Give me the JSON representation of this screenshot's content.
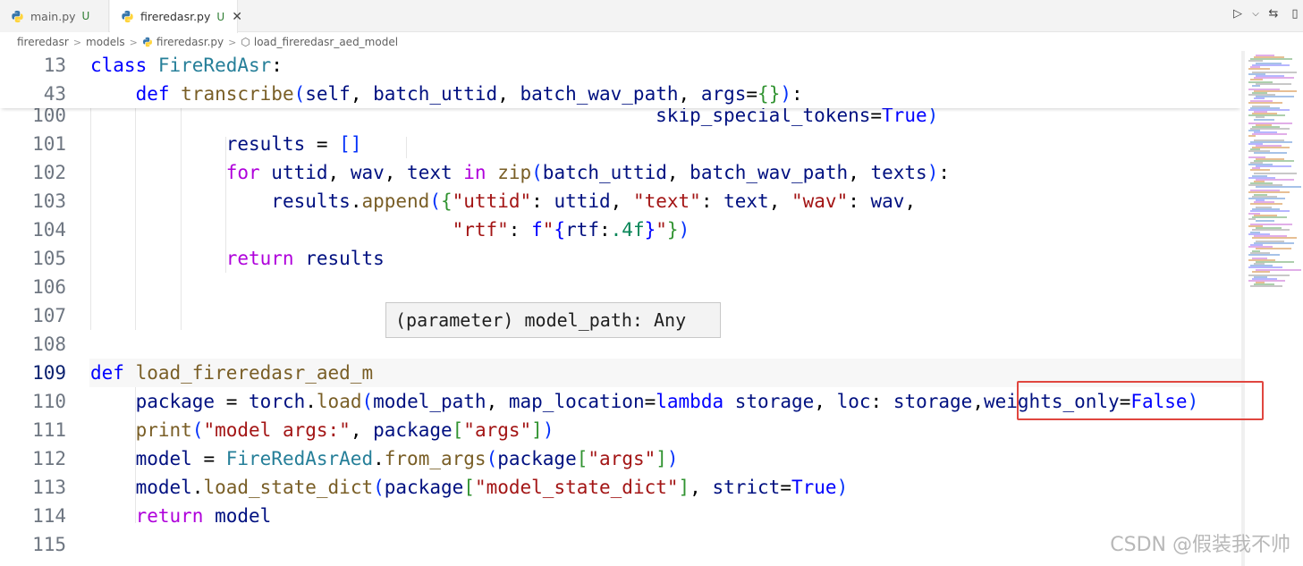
{
  "tabs": [
    {
      "label": "main.py",
      "status": "U",
      "active": false
    },
    {
      "label": "fireredasr.py",
      "status": "U",
      "active": true,
      "close": "✕"
    }
  ],
  "toolbar": {
    "run": "▷",
    "run_menu": "⌵",
    "compare": "⇆",
    "split": "▯"
  },
  "breadcrumb": [
    "fireredasr",
    "models",
    "fireredasr.py",
    "load_fireredasr_aed_model"
  ],
  "editor": {
    "sticky_lines": [
      {
        "no": "13",
        "tokens": [
          [
            "kw2",
            "class "
          ],
          [
            "cls",
            "FireRedAsr"
          ],
          [
            "plain",
            ":"
          ]
        ]
      },
      {
        "no": "43",
        "tokens": [
          [
            "plain",
            "    "
          ],
          [
            "kw2",
            "def "
          ],
          [
            "fn",
            "transcribe"
          ],
          [
            "br1",
            "("
          ],
          [
            "var",
            "self"
          ],
          [
            "plain",
            ", "
          ],
          [
            "var",
            "batch_uttid"
          ],
          [
            "plain",
            ", "
          ],
          [
            "var",
            "batch_wav_path"
          ],
          [
            "plain",
            ", "
          ],
          [
            "var",
            "args"
          ],
          [
            "plain",
            "="
          ],
          [
            "br2",
            "{}"
          ],
          [
            "br1",
            ")"
          ],
          [
            "plain",
            ":"
          ]
        ]
      }
    ],
    "lines": [
      {
        "no": "100",
        "tokens": [
          [
            "plain",
            "                                                  "
          ],
          [
            "var",
            "skip_special_tokens"
          ],
          [
            "plain",
            "="
          ],
          [
            "kw2",
            "True"
          ],
          [
            "br1",
            ")"
          ]
        ]
      },
      {
        "no": "101",
        "tokens": [
          [
            "plain",
            "            "
          ],
          [
            "var",
            "results"
          ],
          [
            "plain",
            " = "
          ],
          [
            "br1",
            "[]"
          ]
        ]
      },
      {
        "no": "102",
        "tokens": [
          [
            "plain",
            "            "
          ],
          [
            "kw",
            "for "
          ],
          [
            "var",
            "uttid"
          ],
          [
            "plain",
            ", "
          ],
          [
            "var",
            "wav"
          ],
          [
            "plain",
            ", "
          ],
          [
            "var",
            "text"
          ],
          [
            "kw",
            " in "
          ],
          [
            "fn",
            "zip"
          ],
          [
            "br1",
            "("
          ],
          [
            "var",
            "batch_uttid"
          ],
          [
            "plain",
            ", "
          ],
          [
            "var",
            "batch_wav_path"
          ],
          [
            "plain",
            ", "
          ],
          [
            "var",
            "texts"
          ],
          [
            "br1",
            ")"
          ],
          [
            "plain",
            ":"
          ]
        ]
      },
      {
        "no": "103",
        "tokens": [
          [
            "plain",
            "                "
          ],
          [
            "var",
            "results"
          ],
          [
            "plain",
            "."
          ],
          [
            "fn",
            "append"
          ],
          [
            "br1",
            "("
          ],
          [
            "br2",
            "{"
          ],
          [
            "str",
            "\"uttid\""
          ],
          [
            "plain",
            ": "
          ],
          [
            "var",
            "uttid"
          ],
          [
            "plain",
            ", "
          ],
          [
            "str",
            "\"text\""
          ],
          [
            "plain",
            ": "
          ],
          [
            "var",
            "text"
          ],
          [
            "plain",
            ", "
          ],
          [
            "str",
            "\"wav\""
          ],
          [
            "plain",
            ": "
          ],
          [
            "var",
            "wav"
          ],
          [
            "plain",
            ","
          ]
        ]
      },
      {
        "no": "104",
        "tokens": [
          [
            "plain",
            "                                "
          ],
          [
            "str",
            "\"rtf\""
          ],
          [
            "plain",
            ": "
          ],
          [
            "kw2",
            "f"
          ],
          [
            "str",
            "\""
          ],
          [
            "kw2",
            "{"
          ],
          [
            "var",
            "rtf"
          ],
          [
            "plain",
            ":"
          ],
          [
            "num",
            ".4f"
          ],
          [
            "kw2",
            "}"
          ],
          [
            "str",
            "\""
          ],
          [
            "br2",
            "}"
          ],
          [
            "br1",
            ")"
          ]
        ]
      },
      {
        "no": "105",
        "tokens": [
          [
            "plain",
            "            "
          ],
          [
            "kw",
            "return "
          ],
          [
            "var",
            "results"
          ]
        ]
      },
      {
        "no": "106",
        "tokens": []
      },
      {
        "no": "107",
        "tokens": []
      },
      {
        "no": "108",
        "tokens": []
      },
      {
        "no": "109",
        "tokens": [
          [
            "kw2",
            "def "
          ],
          [
            "fn",
            "load_fireredasr_aed_m"
          ]
        ]
      },
      {
        "no": "110",
        "tokens": [
          [
            "plain",
            "    "
          ],
          [
            "var",
            "package"
          ],
          [
            "plain",
            " = "
          ],
          [
            "var",
            "torch"
          ],
          [
            "plain",
            "."
          ],
          [
            "fn",
            "load"
          ],
          [
            "br1",
            "("
          ],
          [
            "var",
            "model_path"
          ],
          [
            "plain",
            ", "
          ],
          [
            "var",
            "map_location"
          ],
          [
            "plain",
            "="
          ],
          [
            "kw2",
            "lambda "
          ],
          [
            "var",
            "storage"
          ],
          [
            "plain",
            ", "
          ],
          [
            "var",
            "loc"
          ],
          [
            "plain",
            ": "
          ],
          [
            "var",
            "storage"
          ],
          [
            "plain",
            ","
          ],
          [
            "var",
            "weights_only"
          ],
          [
            "plain",
            "="
          ],
          [
            "kw2",
            "False"
          ],
          [
            "br1",
            ")"
          ]
        ]
      },
      {
        "no": "111",
        "tokens": [
          [
            "plain",
            "    "
          ],
          [
            "fn",
            "print"
          ],
          [
            "br1",
            "("
          ],
          [
            "str",
            "\"model args:\""
          ],
          [
            "plain",
            ", "
          ],
          [
            "var",
            "package"
          ],
          [
            "br2",
            "["
          ],
          [
            "str",
            "\"args\""
          ],
          [
            "br2",
            "]"
          ],
          [
            "br1",
            ")"
          ]
        ]
      },
      {
        "no": "112",
        "tokens": [
          [
            "plain",
            "    "
          ],
          [
            "var",
            "model"
          ],
          [
            "plain",
            " = "
          ],
          [
            "cls",
            "FireRedAsrAed"
          ],
          [
            "plain",
            "."
          ],
          [
            "fn",
            "from_args"
          ],
          [
            "br1",
            "("
          ],
          [
            "var",
            "package"
          ],
          [
            "br2",
            "["
          ],
          [
            "str",
            "\"args\""
          ],
          [
            "br2",
            "]"
          ],
          [
            "br1",
            ")"
          ]
        ]
      },
      {
        "no": "113",
        "tokens": [
          [
            "plain",
            "    "
          ],
          [
            "var",
            "model"
          ],
          [
            "plain",
            "."
          ],
          [
            "fn",
            "load_state_dict"
          ],
          [
            "br1",
            "("
          ],
          [
            "var",
            "package"
          ],
          [
            "br2",
            "["
          ],
          [
            "str",
            "\"model_state_dict\""
          ],
          [
            "br2",
            "]"
          ],
          [
            "plain",
            ", "
          ],
          [
            "var",
            "strict"
          ],
          [
            "plain",
            "="
          ],
          [
            "kw2",
            "True"
          ],
          [
            "br1",
            ")"
          ]
        ]
      },
      {
        "no": "114",
        "tokens": [
          [
            "plain",
            "    "
          ],
          [
            "kw",
            "return "
          ],
          [
            "var",
            "model"
          ]
        ]
      },
      {
        "no": "115",
        "tokens": []
      }
    ],
    "current_line": "109"
  },
  "hover_tooltip": "(parameter) model_path: Any",
  "watermark": "CSDN @假装我不帅",
  "colors": {
    "annotation": "#e0463f",
    "python_blue": "#3776ab",
    "python_yellow": "#ffd43b"
  }
}
